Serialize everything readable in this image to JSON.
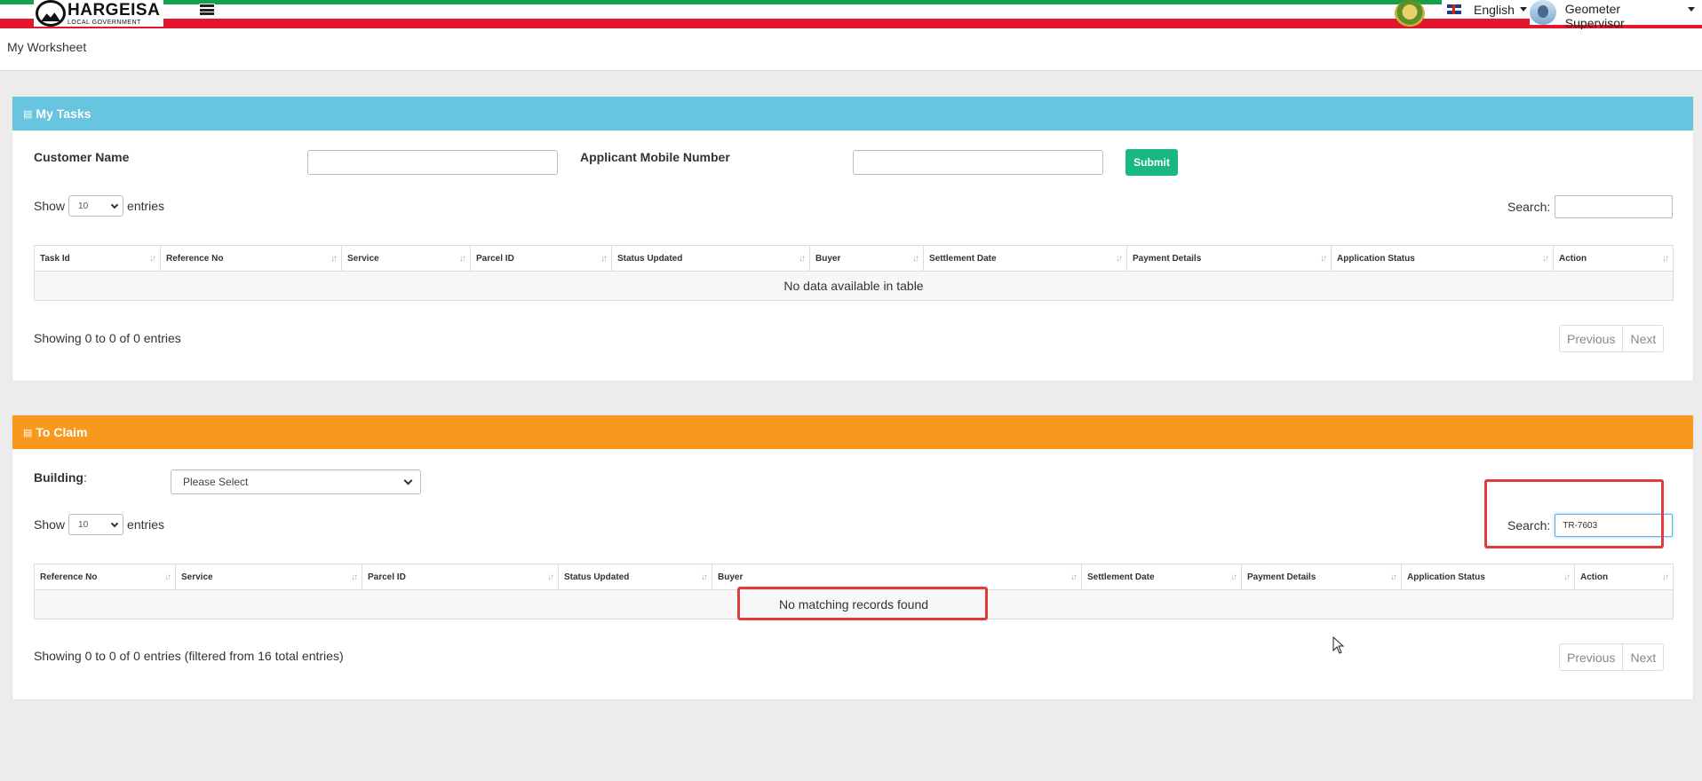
{
  "header": {
    "logo_name": "HARGEISA",
    "logo_sub": "LOCAL GOVERNMENT",
    "language": "English",
    "user": "Geometer Supervisor"
  },
  "page": {
    "title": "My Worksheet"
  },
  "tasks": {
    "title": "My Tasks",
    "customer_name_label": "Customer Name",
    "mobile_label": "Applicant Mobile Number",
    "submit_label": "Submit",
    "show_label": "Show",
    "entries_value": "10",
    "entries_label": "entries",
    "search_label": "Search:",
    "search_value": "",
    "columns": [
      "Task Id",
      "Reference No",
      "Service",
      "Parcel ID",
      "Status Updated",
      "Buyer",
      "Settlement Date",
      "Payment Details",
      "Application Status",
      "Action"
    ],
    "empty_text": "No data available in table",
    "info": "Showing 0 to 0 of 0 entries",
    "previous": "Previous",
    "next": "Next"
  },
  "claim": {
    "title": "To Claim",
    "building_label": "Building",
    "building_colon": ":",
    "building_value": "Please Select",
    "show_label": "Show",
    "entries_value": "10",
    "entries_label": "entries",
    "search_label": "Search:",
    "search_value": "TR-7603",
    "columns": [
      "Reference No",
      "Service",
      "Parcel ID",
      "Status Updated",
      "Buyer",
      "Settlement Date",
      "Payment Details",
      "Application Status",
      "Action"
    ],
    "empty_text": "No matching records found",
    "info": "Showing 0 to 0 of 0 entries (filtered from 16 total entries)",
    "previous": "Previous",
    "next": "Next"
  },
  "colors": {
    "tasks_header": "#67c5df",
    "claim_header": "#f8991d",
    "submit": "#19b882",
    "highlight": "#e03c3c",
    "flag_green": "#13a04a",
    "flag_red": "#e2162d"
  }
}
